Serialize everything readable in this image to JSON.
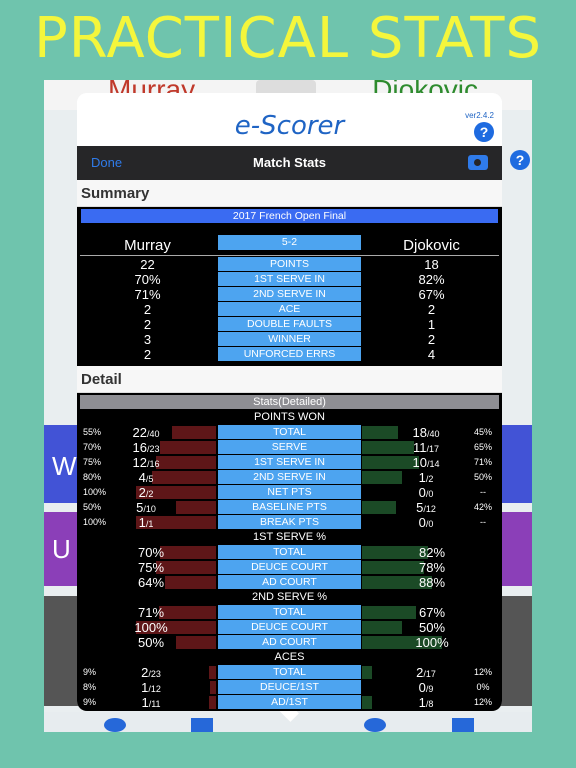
{
  "banner": "PRACTICAL STATS",
  "background": {
    "player_left": "Murray",
    "player_right": "Djokovic",
    "left_letter_1": "W",
    "left_letter_2": "U",
    "help": "?"
  },
  "header": {
    "title": "e-Scorer",
    "version": "ver2.4.2",
    "help": "?"
  },
  "navbar": {
    "done": "Done",
    "title": "Match Stats"
  },
  "summary": {
    "section": "Summary",
    "event": "2017 French Open Final",
    "player_left": "Murray",
    "player_right": "Djokovic",
    "score": "5-2",
    "rows": [
      {
        "label": "POINTS",
        "left": "22",
        "right": "18"
      },
      {
        "label": "1ST SERVE IN",
        "left": "70%",
        "right": "82%"
      },
      {
        "label": "2ND SERVE IN",
        "left": "71%",
        "right": "67%"
      },
      {
        "label": "ACE",
        "left": "2",
        "right": "2"
      },
      {
        "label": "DOUBLE FAULTS",
        "left": "2",
        "right": "1"
      },
      {
        "label": "WINNER",
        "left": "3",
        "right": "2"
      },
      {
        "label": "UNFORCED ERRS",
        "left": "2",
        "right": "4"
      }
    ]
  },
  "detail": {
    "section": "Detail",
    "heading": "Stats(Detailed)",
    "points_won": {
      "title": "POINTS WON",
      "rows": [
        {
          "label": "TOTAL",
          "lp": "55%",
          "l": "22",
          "ld": "/40",
          "r": "18",
          "rd": "/40",
          "rp": "45%",
          "lf": 0.55,
          "rf": 0.45
        },
        {
          "label": "SERVE",
          "lp": "70%",
          "l": "16",
          "ld": "/23",
          "r": "11",
          "rd": "/17",
          "rp": "65%",
          "lf": 0.7,
          "rf": 0.65
        },
        {
          "label": "1ST SERVE IN",
          "lp": "75%",
          "l": "12",
          "ld": "/16",
          "r": "10",
          "rd": "/14",
          "rp": "71%",
          "lf": 0.75,
          "rf": 0.71
        },
        {
          "label": "2ND SERVE IN",
          "lp": "80%",
          "l": "4",
          "ld": "/5",
          "r": "1",
          "rd": "/2",
          "rp": "50%",
          "lf": 0.8,
          "rf": 0.5
        },
        {
          "label": "NET PTS",
          "lp": "100%",
          "l": "2",
          "ld": "/2",
          "r": "0",
          "rd": "/0",
          "rp": "--",
          "lf": 1.0,
          "rf": 0
        },
        {
          "label": "BASELINE PTS",
          "lp": "50%",
          "l": "5",
          "ld": "/10",
          "r": "5",
          "rd": "/12",
          "rp": "42%",
          "lf": 0.5,
          "rf": 0.42
        },
        {
          "label": "BREAK PTS",
          "lp": "100%",
          "l": "1",
          "ld": "/1",
          "r": "0",
          "rd": "/0",
          "rp": "--",
          "lf": 1.0,
          "rf": 0
        }
      ]
    },
    "first_serve": {
      "title": "1ST SERVE %",
      "rows": [
        {
          "label": "TOTAL",
          "l": "70%",
          "r": "82%",
          "lf": 0.7,
          "rf": 0.82
        },
        {
          "label": "DEUCE COURT",
          "l": "75%",
          "r": "78%",
          "lf": 0.75,
          "rf": 0.78
        },
        {
          "label": "AD COURT",
          "l": "64%",
          "r": "88%",
          "lf": 0.64,
          "rf": 0.88
        }
      ]
    },
    "second_serve": {
      "title": "2ND SERVE %",
      "rows": [
        {
          "label": "TOTAL",
          "l": "71%",
          "r": "67%",
          "lf": 0.71,
          "rf": 0.67
        },
        {
          "label": "DEUCE COURT",
          "l": "100%",
          "r": "50%",
          "lf": 1.0,
          "rf": 0.5
        },
        {
          "label": "AD COURT",
          "l": "50%",
          "r": "100%",
          "lf": 0.5,
          "rf": 1.0
        }
      ]
    },
    "aces": {
      "title": "ACES",
      "rows": [
        {
          "label": "TOTAL",
          "lp": "9%",
          "l": "2",
          "ld": "/23",
          "r": "2",
          "rd": "/17",
          "rp": "12%",
          "lf": 0.09,
          "rf": 0.12
        },
        {
          "label": "DEUCE/1ST",
          "lp": "8%",
          "l": "1",
          "ld": "/12",
          "r": "0",
          "rd": "/9",
          "rp": "0%",
          "lf": 0.08,
          "rf": 0
        },
        {
          "label": "AD/1ST",
          "lp": "9%",
          "l": "1",
          "ld": "/11",
          "r": "1",
          "rd": "/8",
          "rp": "12%",
          "lf": 0.09,
          "rf": 0.12
        }
      ]
    }
  },
  "colors": {
    "banner": "#f4f63c",
    "bg": "#6fc4ad",
    "accent": "#1f64c4",
    "cell": "#4da4f0",
    "event": "#3a6bf2",
    "left_bar": "#5e1618",
    "right_bar": "#1b4a26"
  }
}
